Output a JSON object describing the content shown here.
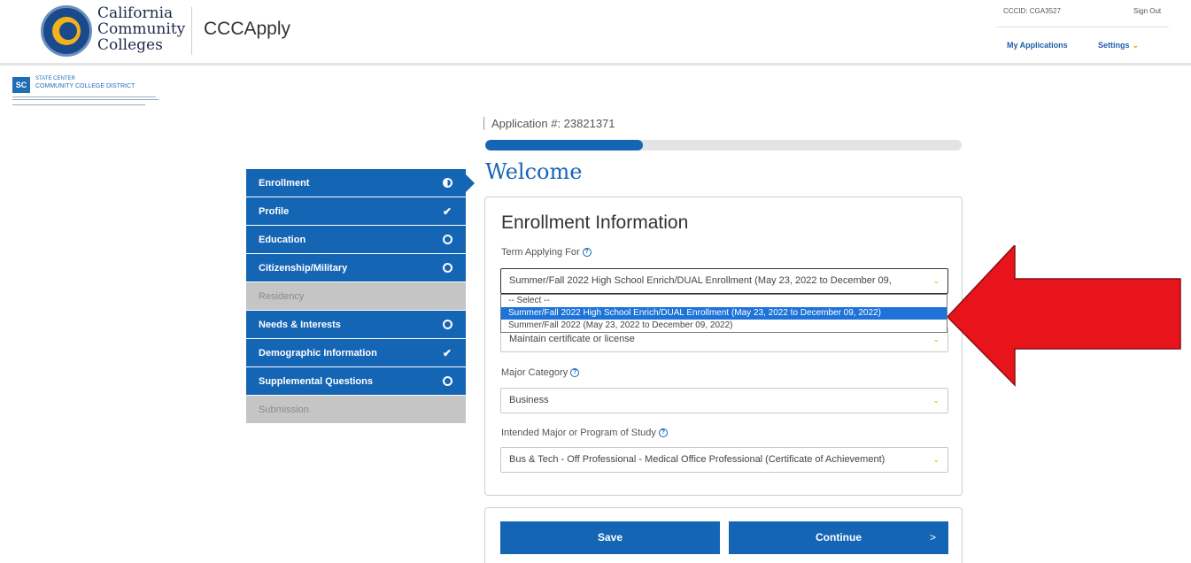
{
  "header": {
    "logo_lines": [
      "California",
      "Community",
      "Colleges"
    ],
    "app_name": "CCCApply",
    "cccid": "CCCID: CGA3527",
    "sign_out": "Sign Out",
    "my_applications": "My Applications",
    "settings": "Settings"
  },
  "district": {
    "line1": "STATE CENTER",
    "line2": "COMMUNITY COLLEGE DISTRICT"
  },
  "application_number": "Application #: 23821371",
  "progress_fraction": 0.33,
  "welcome": "Welcome",
  "sidebar": {
    "items": [
      {
        "label": "Enrollment",
        "status": "partial",
        "enabled": true
      },
      {
        "label": "Profile",
        "status": "complete",
        "enabled": true
      },
      {
        "label": "Education",
        "status": "incomplete",
        "enabled": true
      },
      {
        "label": "Citizenship/Military",
        "status": "incomplete",
        "enabled": true
      },
      {
        "label": "Residency",
        "status": "none",
        "enabled": false
      },
      {
        "label": "Needs & Interests",
        "status": "incomplete",
        "enabled": true
      },
      {
        "label": "Demographic Information",
        "status": "complete",
        "enabled": true
      },
      {
        "label": "Supplemental Questions",
        "status": "incomplete",
        "enabled": true
      },
      {
        "label": "Submission",
        "status": "none",
        "enabled": false
      }
    ]
  },
  "form": {
    "title": "Enrollment Information",
    "term": {
      "label": "Term Applying For",
      "value": "Summer/Fall 2022 High School Enrich/DUAL Enrollment (May 23, 2022 to December 09,",
      "options": [
        "-- Select --",
        "Summer/Fall 2022 High School Enrich/DUAL Enrollment (May 23, 2022 to December 09, 2022)",
        "Summer/Fall 2022 (May 23, 2022 to December 09, 2022)"
      ],
      "highlighted_index": 1
    },
    "goal": {
      "value": "Maintain certificate or license"
    },
    "major_category": {
      "label": "Major Category",
      "value": "Business"
    },
    "intended_major": {
      "label": "Intended Major or Program of Study",
      "value": "Bus & Tech - Off Professional - Medical Office Professional (Certificate of Achievement)"
    }
  },
  "buttons": {
    "save": "Save",
    "continue": "Continue",
    "continue_arrow": ">"
  },
  "colors": {
    "primary": "#1565b5",
    "accent": "#f0a500",
    "disabled": "#c5c5c5",
    "annotation": "#e8141c"
  }
}
